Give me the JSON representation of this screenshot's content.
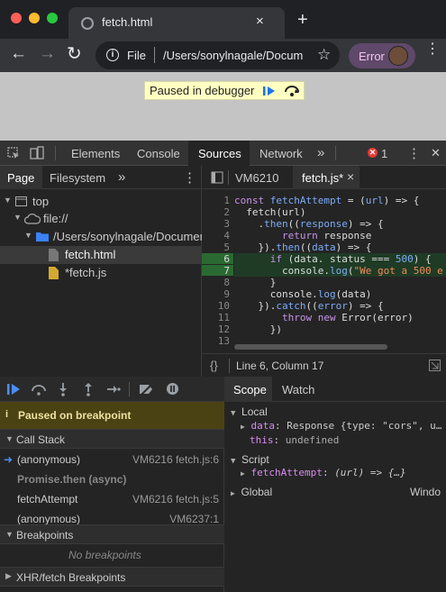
{
  "browser": {
    "tab_title": "fetch.html",
    "tab_close": "×",
    "new_tab": "+",
    "back": "←",
    "forward": "→",
    "reload": "↻",
    "info": "i",
    "scheme": "File",
    "url": "/Users/sonylnagale/Document/fetch.html",
    "star": "☆",
    "error_label": "Error",
    "menu": "⋮"
  },
  "page": {
    "paused_label": "Paused in debugger"
  },
  "devtools": {
    "tabs": [
      "Elements",
      "Console",
      "Sources",
      "Network"
    ],
    "active_tab": "Sources",
    "more_tabs": "»",
    "error_count": "1",
    "menu": "⋮",
    "close": "✕"
  },
  "navigator": {
    "tabs": [
      "Page",
      "Filesystem"
    ],
    "more": "»",
    "menu": "⋮",
    "tree": [
      {
        "label": "top"
      },
      {
        "label": "file://"
      },
      {
        "label": "/Users/sonylnagale/Document"
      },
      {
        "label": "fetch.html"
      },
      {
        "label": "*fetch.js"
      }
    ]
  },
  "editor": {
    "tabs": [
      {
        "label": "VM6210"
      },
      {
        "label": "fetch.js*",
        "close": "×"
      }
    ],
    "line_numbers": [
      "1",
      "2",
      "3",
      "4",
      "5",
      "6",
      "7",
      "8",
      "9",
      "10",
      "11",
      "12",
      "13"
    ],
    "code_lines": [
      [
        {
          "t": "const ",
          "c": "k"
        },
        {
          "t": "fetchAttempt",
          "c": "n"
        },
        {
          "t": " = (",
          "c": "f"
        },
        {
          "t": "url",
          "c": "n"
        },
        {
          "t": ") => {",
          "c": "f"
        }
      ],
      [
        {
          "t": "  fetch(url)",
          "c": "f"
        }
      ],
      [
        {
          "t": "    .",
          "c": "f"
        },
        {
          "t": "then",
          "c": "n"
        },
        {
          "t": "((",
          "c": "f"
        },
        {
          "t": "response",
          "c": "n"
        },
        {
          "t": ") => {",
          "c": "f"
        }
      ],
      [
        {
          "t": "        ",
          "c": "f"
        },
        {
          "t": "return",
          "c": "k"
        },
        {
          "t": " response",
          "c": "f"
        }
      ],
      [
        {
          "t": "    }).",
          "c": "f"
        },
        {
          "t": "then",
          "c": "n"
        },
        {
          "t": "((",
          "c": "f"
        },
        {
          "t": "data",
          "c": "n"
        },
        {
          "t": ") => {",
          "c": "f"
        }
      ],
      [
        {
          "t": "      ",
          "c": "f"
        },
        {
          "t": "if",
          "c": "k"
        },
        {
          "t": " (data. status === ",
          "c": "f"
        },
        {
          "t": "500",
          "c": "n"
        },
        {
          "t": ") {",
          "c": "f"
        }
      ],
      [
        {
          "t": "        console.",
          "c": "f"
        },
        {
          "t": "log",
          "c": "n"
        },
        {
          "t": "(",
          "c": "f"
        },
        {
          "t": "\"We got a 500 e",
          "c": "s"
        }
      ],
      [
        {
          "t": "      }",
          "c": "f"
        }
      ],
      [
        {
          "t": "      console.",
          "c": "f"
        },
        {
          "t": "log",
          "c": "n"
        },
        {
          "t": "(data)",
          "c": "f"
        }
      ],
      [
        {
          "t": "    }).",
          "c": "f"
        },
        {
          "t": "catch",
          "c": "n"
        },
        {
          "t": "((",
          "c": "f"
        },
        {
          "t": "error",
          "c": "n"
        },
        {
          "t": ") => {",
          "c": "f"
        }
      ],
      [
        {
          "t": "        ",
          "c": "f"
        },
        {
          "t": "throw",
          "c": "k"
        },
        {
          "t": " ",
          "c": "f"
        },
        {
          "t": "new",
          "c": "k"
        },
        {
          "t": " Error(error)",
          "c": "f"
        }
      ],
      [
        {
          "t": "      })",
          "c": "f"
        }
      ],
      [
        {
          "t": "",
          "c": "f"
        }
      ]
    ],
    "breakpoint_lines": [
      6,
      7
    ],
    "status_braces": "{}",
    "status_position": "Line 6, Column 17"
  },
  "debugger": {
    "paused_banner": "Paused on breakpoint",
    "call_stack_title": "Call Stack",
    "frames": [
      {
        "name": "(anonymous)",
        "location": "VM6216 fetch.js:6",
        "current": true
      },
      {
        "name": "Promise.then (async)",
        "location": "",
        "async": true
      },
      {
        "name": "fetchAttempt",
        "location": "VM6216 fetch.js:5"
      },
      {
        "name": "(anonymous)",
        "location": "VM6237:1"
      }
    ],
    "breakpoints_title": "Breakpoints",
    "no_breakpoints": "No breakpoints",
    "xhr_title": "XHR/fetch Breakpoints"
  },
  "scope": {
    "tabs": [
      "Scope",
      "Watch"
    ],
    "active_tab": "Scope",
    "local_title": "Local",
    "data_key": "data",
    "data_value": "Response {type: \"cors\", u…",
    "this_key": "this",
    "this_value": "undefined",
    "script_title": "Script",
    "fetchAttempt_key": "fetchAttempt",
    "fetchAttempt_value": "(url) => {…}",
    "global_title": "Global",
    "global_value": "Windo"
  },
  "colors": {
    "accent": "#1a73e8",
    "breakpoint": "#2a6a32",
    "paused_banner": "#4a4213",
    "error_pill": "#5f4869"
  }
}
